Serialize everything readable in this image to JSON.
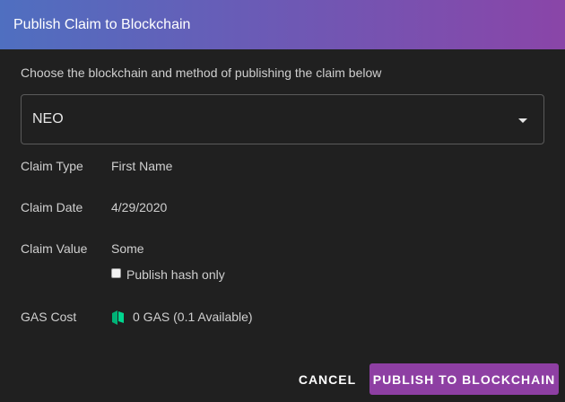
{
  "dialog": {
    "title": "Publish Claim to Blockchain",
    "instructions": "Choose the blockchain and method of publishing the claim below"
  },
  "blockchain_select": {
    "selected": "NEO",
    "icon": "caret-down-icon"
  },
  "claim": {
    "type_label": "Claim Type",
    "type_value": "First Name",
    "date_label": "Claim Date",
    "date_value": "4/29/2020",
    "value_label": "Claim Value",
    "value_value": "Some",
    "hash_only_label": "Publish hash only",
    "hash_only_checked": false
  },
  "gas": {
    "label": "GAS Cost",
    "value": "0 GAS (0.1 Available)",
    "icon": "gas-token-icon",
    "icon_color": "#00d68f"
  },
  "actions": {
    "cancel_label": "CANCEL",
    "publish_label": "PUBLISH TO BLOCKCHAIN"
  },
  "colors": {
    "header_gradient_start": "#4f6fc0",
    "header_gradient_end": "#8a45a8",
    "background": "#202020",
    "primary_button": "#8e3fa3"
  }
}
